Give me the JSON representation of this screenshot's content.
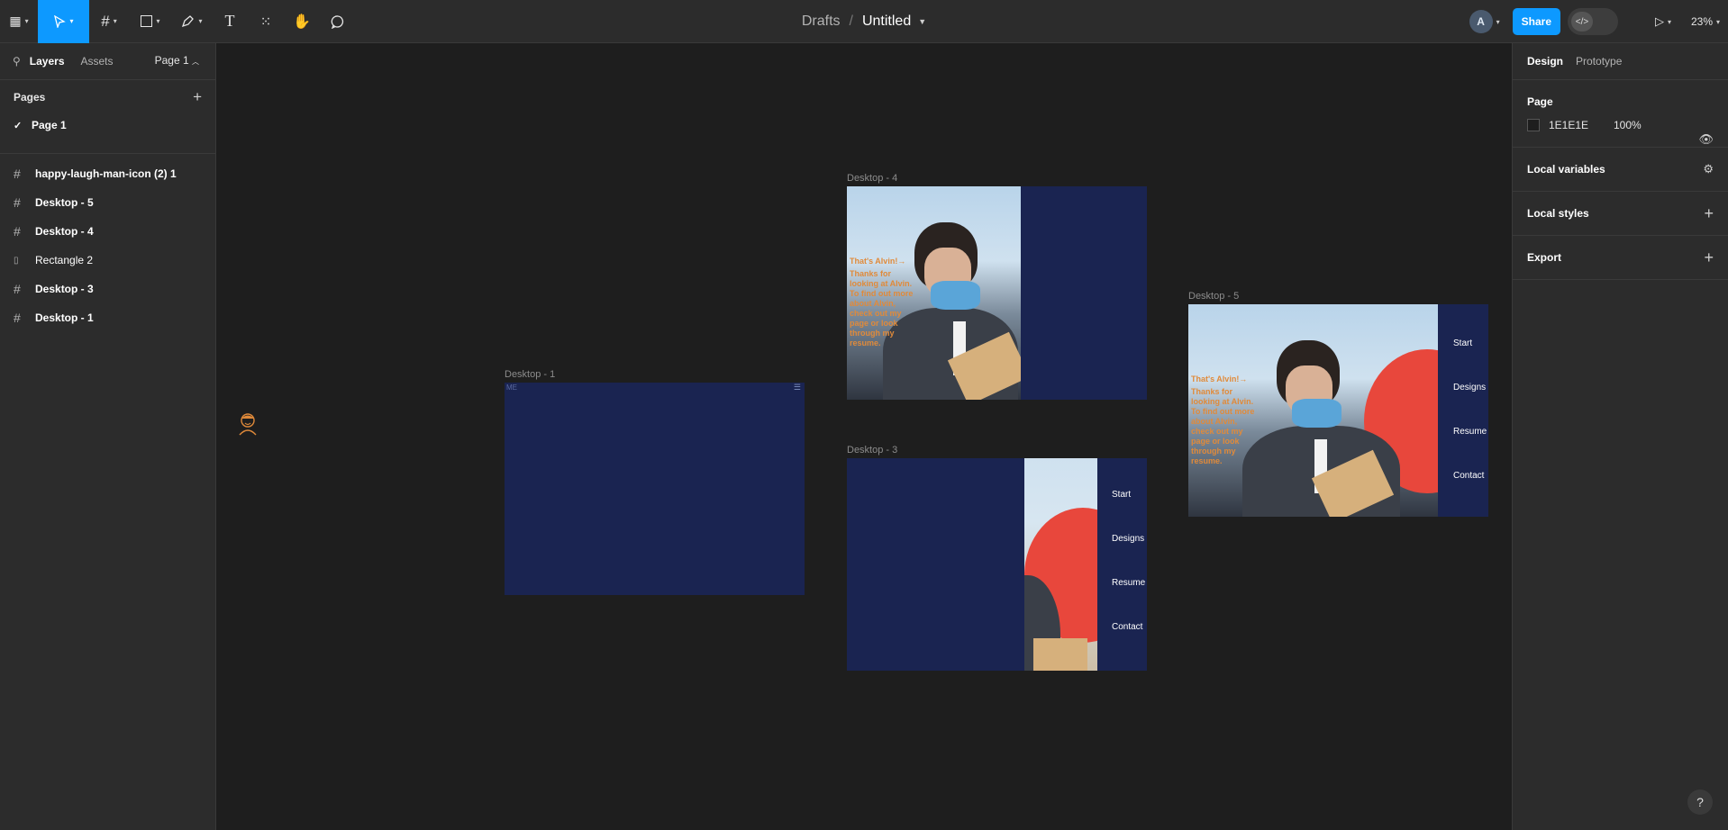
{
  "toolbar": {
    "tools": [
      {
        "name": "main-menu",
        "icon": "figma-logo-icon"
      },
      {
        "name": "move",
        "icon": "cursor-icon"
      },
      {
        "name": "frame",
        "icon": "frame-hash-icon"
      },
      {
        "name": "rectangle",
        "icon": "rectangle-icon"
      },
      {
        "name": "pen",
        "icon": "pen-icon"
      },
      {
        "name": "text",
        "icon": "text-icon",
        "glyph": "T"
      },
      {
        "name": "resources",
        "icon": "components-icon"
      },
      {
        "name": "hand",
        "icon": "hand-icon"
      },
      {
        "name": "comment",
        "icon": "comment-icon"
      }
    ],
    "breadcrumb_parent": "Drafts",
    "breadcrumb_sep": "/",
    "file_name": "Untitled",
    "avatar_initial": "A",
    "share_label": "Share",
    "zoom": "23%"
  },
  "left_panel": {
    "tabs": [
      "Layers",
      "Assets"
    ],
    "page_selector": "Page 1",
    "pages_heading": "Pages",
    "pages": [
      "Page 1"
    ],
    "layers": [
      {
        "label": "happy-laugh-man-icon (2) 1",
        "type": "frame"
      },
      {
        "label": "Desktop - 5",
        "type": "frame"
      },
      {
        "label": "Desktop - 4",
        "type": "frame"
      },
      {
        "label": "Rectangle 2",
        "type": "rect"
      },
      {
        "label": "Desktop - 3",
        "type": "frame"
      },
      {
        "label": "Desktop - 1",
        "type": "frame"
      }
    ]
  },
  "right_panel": {
    "tabs": [
      "Design",
      "Prototype"
    ],
    "page_heading": "Page",
    "page_color": "1E1E1E",
    "page_opacity": "100%",
    "local_variables": "Local variables",
    "local_styles": "Local styles",
    "export": "Export"
  },
  "canvas": {
    "frames": [
      {
        "label": "Desktop - 1"
      },
      {
        "label": "Desktop - 4",
        "text_title": "That's Alvin!→",
        "text_body": "Thanks for looking at Alvin. To find out more about Alvin, check out my page or look through my resume."
      },
      {
        "label": "Desktop - 3",
        "nav": [
          "Start",
          "Designs",
          "Resume",
          "Contact"
        ]
      },
      {
        "label": "Desktop - 5",
        "text_title": "That's Alvin!→",
        "text_body": "Thanks for looking at Alvin. To find out more about Alvin, check out my page or look through my resume.",
        "nav": [
          "Start",
          "Designs",
          "Resume",
          "Contact"
        ]
      }
    ]
  },
  "help_label": "?",
  "colors": {
    "accent": "#0d99ff",
    "frame_bg": "#1a2451",
    "canvas_bg": "#1e1e1e"
  }
}
